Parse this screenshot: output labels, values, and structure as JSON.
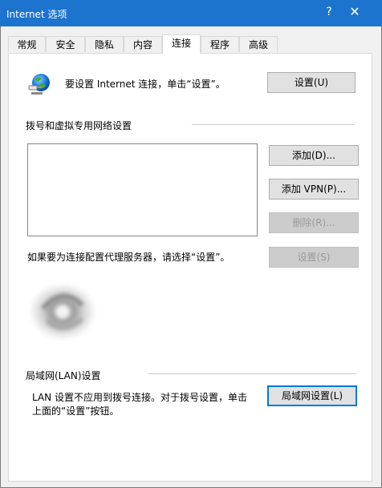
{
  "window": {
    "title": "Internet 选项",
    "help_glyph": "?",
    "close_glyph": "✕"
  },
  "tabs": [
    {
      "label": "常规"
    },
    {
      "label": "安全"
    },
    {
      "label": "隐私"
    },
    {
      "label": "内容"
    },
    {
      "label": "连接",
      "active": true
    },
    {
      "label": "程序"
    },
    {
      "label": "高级"
    }
  ],
  "setup": {
    "text": "要设置 Internet 连接，单击“设置”。",
    "button": "设置(U)"
  },
  "dialup": {
    "group_label": "拨号和虚拟专用网络设置",
    "add_button": "添加(D)...",
    "add_vpn_button": "添加 VPN(P)...",
    "delete_button": "删除(R)...",
    "proxy_text": "如果要为连接配置代理服务器，请选择“设置”。",
    "settings_button": "设置(S)"
  },
  "lan": {
    "group_label": "局域网(LAN)设置",
    "text_line1": "LAN 设置不应用到拨号连接。对于拨号设置，单击",
    "text_line2": "上面的“设置”按钮。",
    "button": "局域网设置(L)"
  }
}
